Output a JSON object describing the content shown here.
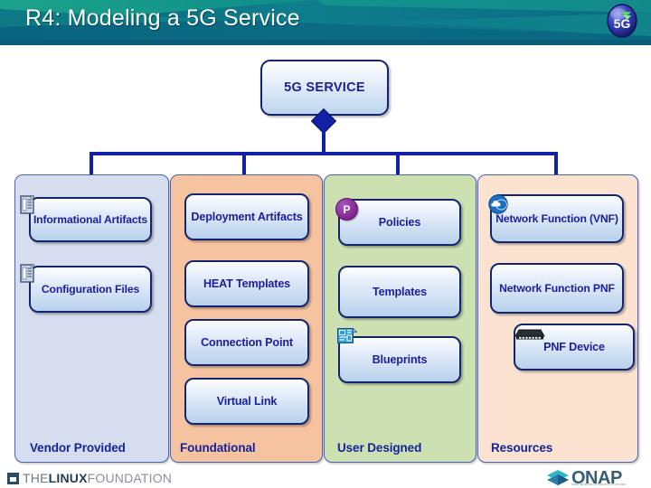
{
  "header": {
    "title": "R4: Modeling a 5G Service",
    "logo_label": "5G",
    "logo_name": "5g-logo",
    "bg_color": "#0b6f86",
    "accent_color": "#1aa089"
  },
  "diagram": {
    "root": {
      "label": "5G SERVICE",
      "connector_shape": "diamond"
    },
    "columns": [
      {
        "id": "vendor",
        "footer": "Vendor Provided",
        "bg_color": "#d6ddef",
        "nodes": [
          {
            "label": "Informational Artifacts",
            "icon": "document-icon"
          },
          {
            "label": "Configuration Files",
            "icon": "document-icon"
          }
        ]
      },
      {
        "id": "foundational",
        "footer": "Foundational",
        "bg_color": "#f6c3a0",
        "nodes": [
          {
            "label": "Deployment Artifacts",
            "icon": null
          },
          {
            "label": "HEAT Templates",
            "icon": null
          },
          {
            "label": "Connection Point",
            "icon": null
          },
          {
            "label": "Virtual Link",
            "icon": null
          }
        ]
      },
      {
        "id": "user-designed",
        "footer": "User Designed",
        "bg_color": "#cce0b2",
        "nodes": [
          {
            "label": "Policies",
            "icon": "policy-p-icon",
            "icon_label": "P"
          },
          {
            "label": "Templates",
            "icon": null
          },
          {
            "label": "Blueprints",
            "icon": "blueprint-icon"
          }
        ]
      },
      {
        "id": "resources",
        "footer": "Resources",
        "bg_color": "#fbe2d1",
        "nodes": [
          {
            "label": "Network Function (VNF)",
            "icon": "cloud-icon"
          },
          {
            "label": "Network Function PNF",
            "icon": null
          },
          {
            "label": "PNF Device",
            "icon": "router-icon"
          }
        ]
      }
    ],
    "node_text_color": "#1b1f9e",
    "node_border_color": "#12256e",
    "connector_color": "#1220a8"
  },
  "footer": {
    "linux_foundation": {
      "the": "THE",
      "linux": "LINUX",
      "foundation": "FOUNDATION"
    },
    "onap": {
      "text": "ONAP",
      "tagline": "OPEN NETWORK AUTOMATION PLATFORM"
    }
  }
}
